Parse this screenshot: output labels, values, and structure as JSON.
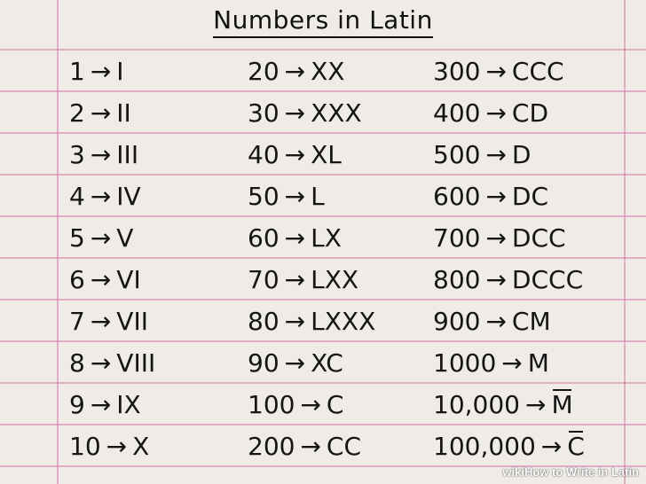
{
  "title": "Numbers in Latin",
  "columns": [
    {
      "rows": [
        {
          "num": "1",
          "arrow": "→",
          "latin": "I"
        },
        {
          "num": "2",
          "arrow": "→",
          "latin": "II"
        },
        {
          "num": "3",
          "arrow": "→",
          "latin": "III"
        },
        {
          "num": "4",
          "arrow": "→",
          "latin": "IV"
        },
        {
          "num": "5",
          "arrow": "→",
          "latin": "V"
        },
        {
          "num": "6",
          "arrow": "→",
          "latin": "VI"
        },
        {
          "num": "7",
          "arrow": "→",
          "latin": "VII"
        },
        {
          "num": "8",
          "arrow": "→",
          "latin": "VIII"
        },
        {
          "num": "9",
          "arrow": "→",
          "latin": "IX"
        },
        {
          "num": "10",
          "arrow": "→",
          "latin": "X"
        }
      ]
    },
    {
      "rows": [
        {
          "num": "20",
          "arrow": "→",
          "latin": "XX"
        },
        {
          "num": "30",
          "arrow": "→",
          "latin": "XXX"
        },
        {
          "num": "40",
          "arrow": "→",
          "latin": "XL"
        },
        {
          "num": "50",
          "arrow": "→",
          "latin": "L"
        },
        {
          "num": "60",
          "arrow": "→",
          "latin": "LX"
        },
        {
          "num": "70",
          "arrow": "→",
          "latin": "LXX"
        },
        {
          "num": "80",
          "arrow": "→",
          "latin": "LXXX"
        },
        {
          "num": "90",
          "arrow": "→",
          "latin": "XC"
        },
        {
          "num": "100",
          "arrow": "→",
          "latin": "C"
        },
        {
          "num": "200",
          "arrow": "→",
          "latin": "CC"
        }
      ]
    },
    {
      "rows": [
        {
          "num": "300",
          "arrow": "→",
          "latin": "CCC"
        },
        {
          "num": "400",
          "arrow": "→",
          "latin": "CD"
        },
        {
          "num": "500",
          "arrow": "→",
          "latin": "D"
        },
        {
          "num": "600",
          "arrow": "→",
          "latin": "DC"
        },
        {
          "num": "700",
          "arrow": "→",
          "latin": "DCC"
        },
        {
          "num": "800",
          "arrow": "→",
          "latin": "DCCC"
        },
        {
          "num": "900",
          "arrow": "→",
          "latin": "CM"
        },
        {
          "num": "1000",
          "arrow": "→",
          "latin": "M"
        },
        {
          "num": "10,000",
          "arrow": "→",
          "latin": "M",
          "overline": true
        },
        {
          "num": "100,000",
          "arrow": "→",
          "latin": "C",
          "overline": true
        }
      ]
    }
  ],
  "watermark": {
    "wiki": "wiki",
    "how": "How",
    "rest": " to Write in Latin"
  },
  "colors": {
    "paper": "#efece7",
    "rule_lines": "#d678aa",
    "ink": "#151515"
  }
}
